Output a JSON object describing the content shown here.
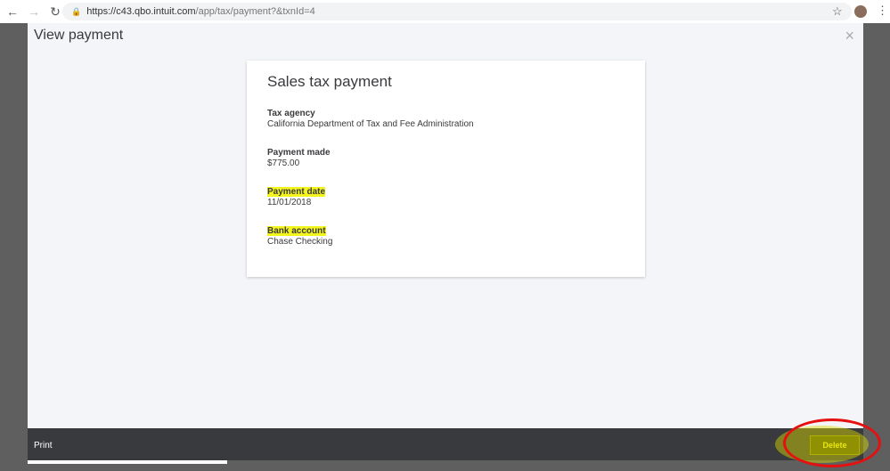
{
  "browser": {
    "url_host": "https://c43.qbo.intuit.com",
    "url_path": "/app/tax/payment?&txnId=4"
  },
  "modal": {
    "title": "View payment",
    "close": "×"
  },
  "card": {
    "title": "Sales tax payment",
    "fields": [
      {
        "label": "Tax agency",
        "value": "California Department of Tax and Fee Administration",
        "highlight": false
      },
      {
        "label": "Payment made",
        "value": "$775.00",
        "highlight": false
      },
      {
        "label": "Payment date",
        "value": "11/01/2018",
        "highlight": true
      },
      {
        "label": "Bank account",
        "value": "Chase Checking",
        "highlight": true
      }
    ]
  },
  "footer": {
    "print": "Print",
    "delete": "Delete"
  },
  "colors": {
    "highlight": "#f5f51e",
    "annotation": "#e51010"
  }
}
